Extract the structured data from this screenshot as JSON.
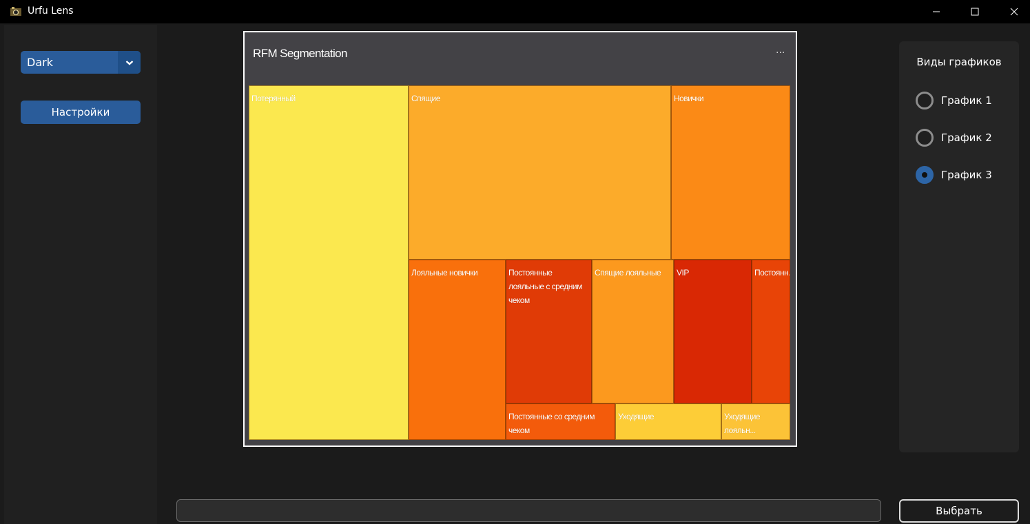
{
  "window": {
    "title": "Urfu Lens",
    "controls": {
      "minimize": "─",
      "maximize": "☐",
      "close": "✕"
    }
  },
  "sidebar": {
    "theme_select": {
      "value": "Dark",
      "icon": "chevron-down-icon"
    },
    "settings_label": "Настройки"
  },
  "chart": {
    "title": "RFM Segmentation",
    "menu_glyph": "···"
  },
  "chart_data": {
    "type": "treemap",
    "title": "RFM Segmentation",
    "segments": [
      {
        "label": "Потерянный",
        "color": "#fbe84f"
      },
      {
        "label": "Спящие",
        "color": "#fcab2a"
      },
      {
        "label": "Новички",
        "color": "#fb8a16"
      },
      {
        "label": "Лояльные новички",
        "color": "#f9700c"
      },
      {
        "label": "Постоянные лояльные с средним чеком",
        "color": "#e03b06"
      },
      {
        "label": "Спящие лояльные",
        "color": "#fc991e"
      },
      {
        "label": "VIP",
        "color": "#d92804"
      },
      {
        "label": "Постоянн...",
        "color": "#e84407"
      },
      {
        "label": "Постоянные со средним чеком",
        "color": "#f35b0b"
      },
      {
        "label": "Уходящие",
        "color": "#fdcd37"
      },
      {
        "label": "Уходящие лояльн...",
        "color": "#fcc337"
      }
    ]
  },
  "right_panel": {
    "title": "Виды графиков",
    "options": [
      {
        "label": "График 1",
        "checked": false
      },
      {
        "label": "График 2",
        "checked": false
      },
      {
        "label": "График 3",
        "checked": true
      }
    ]
  },
  "bottom": {
    "progress_value": 0,
    "select_label": "Выбрать"
  }
}
